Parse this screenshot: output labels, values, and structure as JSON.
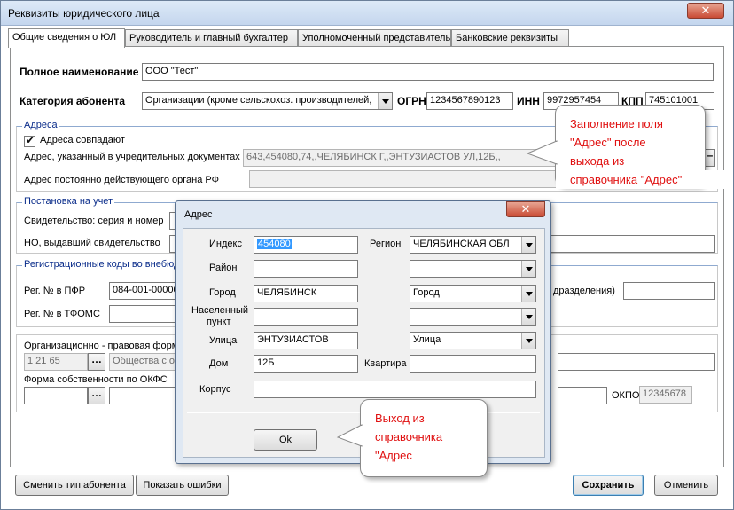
{
  "window": {
    "title": "Реквизиты юридического лица"
  },
  "tabs": [
    "Общие сведения о ЮЛ",
    "Руководитель и главный бухгалтер",
    "Уполномоченный представитель",
    "Банковские реквизиты"
  ],
  "main": {
    "full_name_label": "Полное наименование",
    "full_name_value": "ООО \"Тест\"",
    "category_label": "Категория абонента",
    "category_value": "Организации (кроме сельскохоз. производителей,",
    "ogrn_label": "ОГРН",
    "ogrn_value": "1234567890123",
    "inn_label": "ИНН",
    "inn_value": "9972957454",
    "kpp_label": "КПП",
    "kpp_value": "745101001"
  },
  "address_group": {
    "title": "Адреса",
    "same_checkbox": "Адреса совпадают",
    "founding_label": "Адрес, указанный в учредительных документах",
    "founding_value": "643,454080,74,,ЧЕЛЯБИНСК Г,,ЭНТУЗИАСТОВ УЛ,12Б,,",
    "permanent_label": "Адрес постоянно действующего органа РФ"
  },
  "registration_group": {
    "title": "Постановка на учет",
    "certificate_label": "Свидетельство: серия и номер",
    "tax_office_label": "НО, выдавший свидетельство"
  },
  "codes_group": {
    "title": "Регистрационные коды во внебюд",
    "pfr_label": "Рег. № в ПФР",
    "pfr_value": "084-001-000000",
    "tfoms_label": "Рег. № в ТФОМС",
    "subdivision_tail": "дразделения)"
  },
  "legal_form_group": {
    "opf_label": "Организационно - правовая форма",
    "opf_code": "1 21 65",
    "opf_name": "Общества с огр",
    "okfs_label": "Форма собственности по ОКФС",
    "okpo_label": "ОКПО",
    "okpo_value": "12345678"
  },
  "buttons": {
    "change_type": "Сменить тип абонента",
    "show_errors": "Показать ошибки",
    "save": "Сохранить",
    "cancel": "Отменить"
  },
  "dialog": {
    "title": "Адрес",
    "index_label": "Индекс",
    "index_value": "454080",
    "region_label": "Регион",
    "region_value": "ЧЕЛЯБИНСКАЯ ОБЛ",
    "district_label": "Район",
    "city_label": "Город",
    "city_value": "ЧЕЛЯБИНСК",
    "city_type": "Город",
    "settlement_label_1": "Населенный",
    "settlement_label_2": "пункт",
    "street_label": "Улица",
    "street_value": "ЭНТУЗИАСТОВ",
    "street_type": "Улица",
    "house_label": "Дом",
    "house_value": "12Б",
    "apartment_label": "Квартира",
    "building_label": "Корпус",
    "ok": "Ok"
  },
  "callouts": {
    "top": [
      "Заполнение поля",
      "\"Адрес\" после",
      "выхода из",
      "справочника \"Адрес\""
    ],
    "bottom": [
      "Выход из",
      "справочника",
      "\"Адрес"
    ]
  },
  "colors": {
    "callout_text": "#e01010",
    "group_title": "#0a2c8a",
    "selection": "#3399ff"
  }
}
